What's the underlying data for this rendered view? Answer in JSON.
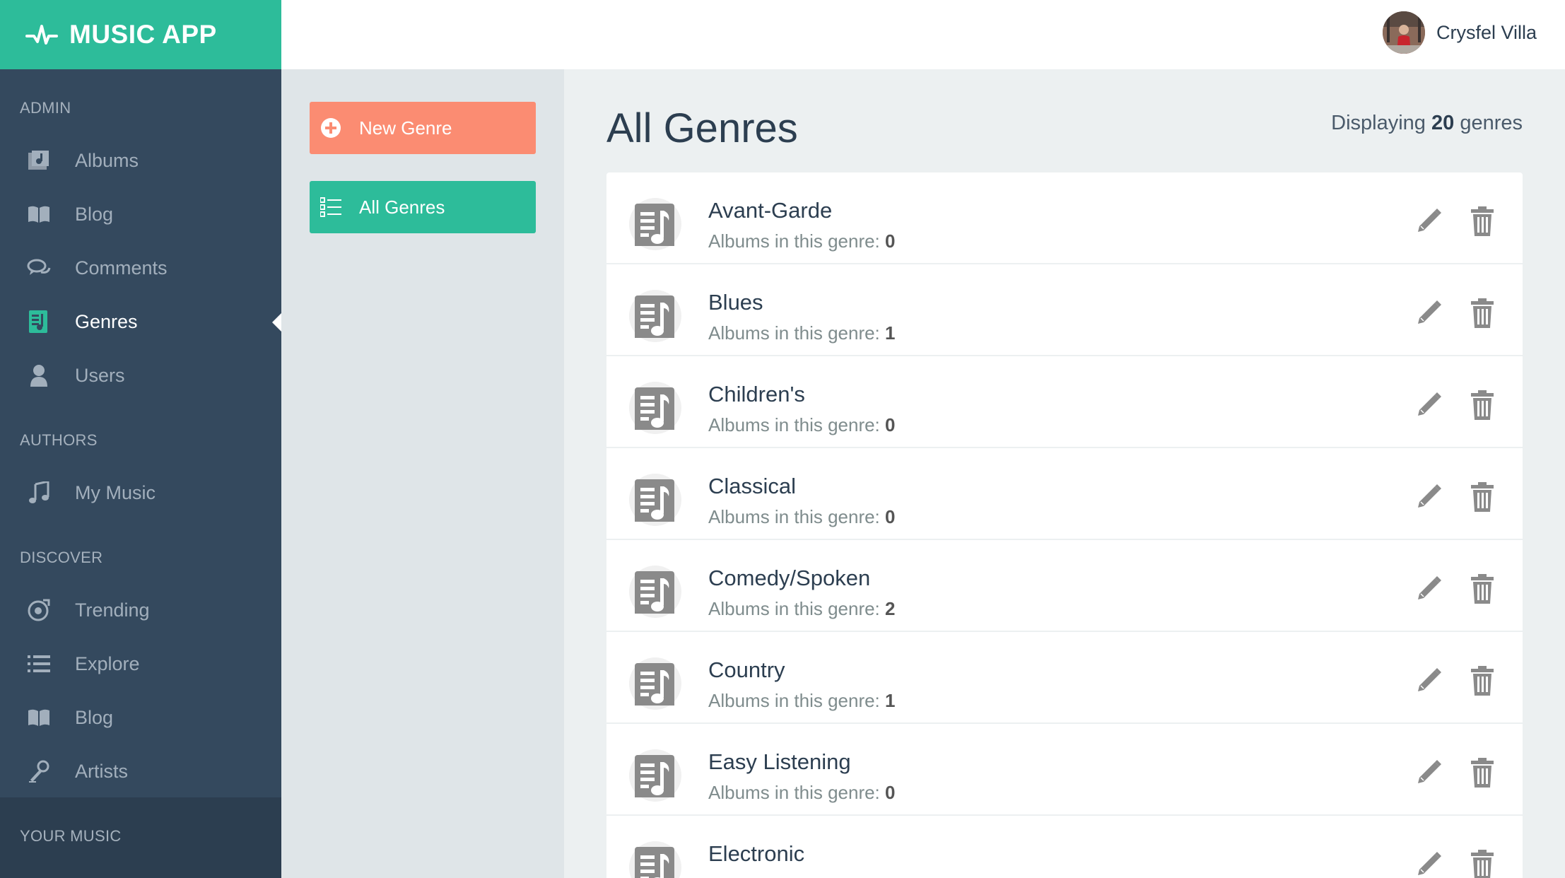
{
  "app": {
    "title": "MUSIC APP",
    "brand_color": "#2dbc9a"
  },
  "user": {
    "name": "Crysfel Villa"
  },
  "sidebar": {
    "sections": [
      {
        "title": "ADMIN",
        "items": [
          {
            "label": "Albums",
            "icon": "album-icon"
          },
          {
            "label": "Blog",
            "icon": "book-icon"
          },
          {
            "label": "Comments",
            "icon": "comments-icon"
          },
          {
            "label": "Genres",
            "icon": "genre-icon",
            "active": true
          },
          {
            "label": "Users",
            "icon": "user-icon"
          }
        ]
      },
      {
        "title": "AUTHORS",
        "items": [
          {
            "label": "My Music",
            "icon": "music-note-icon"
          }
        ]
      },
      {
        "title": "DISCOVER",
        "items": [
          {
            "label": "Trending",
            "icon": "trending-icon"
          },
          {
            "label": "Explore",
            "icon": "list-icon"
          },
          {
            "label": "Blog",
            "icon": "book-icon"
          },
          {
            "label": "Artists",
            "icon": "microphone-icon"
          }
        ]
      },
      {
        "title": "YOUR MUSIC",
        "items": []
      }
    ]
  },
  "subnav": {
    "new_genre": "New Genre",
    "all_genres": "All Genres"
  },
  "main": {
    "title": "All Genres",
    "display_prefix": "Displaying",
    "display_count": "20",
    "display_suffix": "genres",
    "count_label": "Albums in this genre:",
    "genres": [
      {
        "name": "Avant-Garde",
        "count": "0"
      },
      {
        "name": "Blues",
        "count": "1"
      },
      {
        "name": "Children's",
        "count": "0"
      },
      {
        "name": "Classical",
        "count": "0"
      },
      {
        "name": "Comedy/Spoken",
        "count": "2"
      },
      {
        "name": "Country",
        "count": "1"
      },
      {
        "name": "Easy Listening",
        "count": "0"
      },
      {
        "name": "Electronic",
        "count": ""
      }
    ]
  }
}
